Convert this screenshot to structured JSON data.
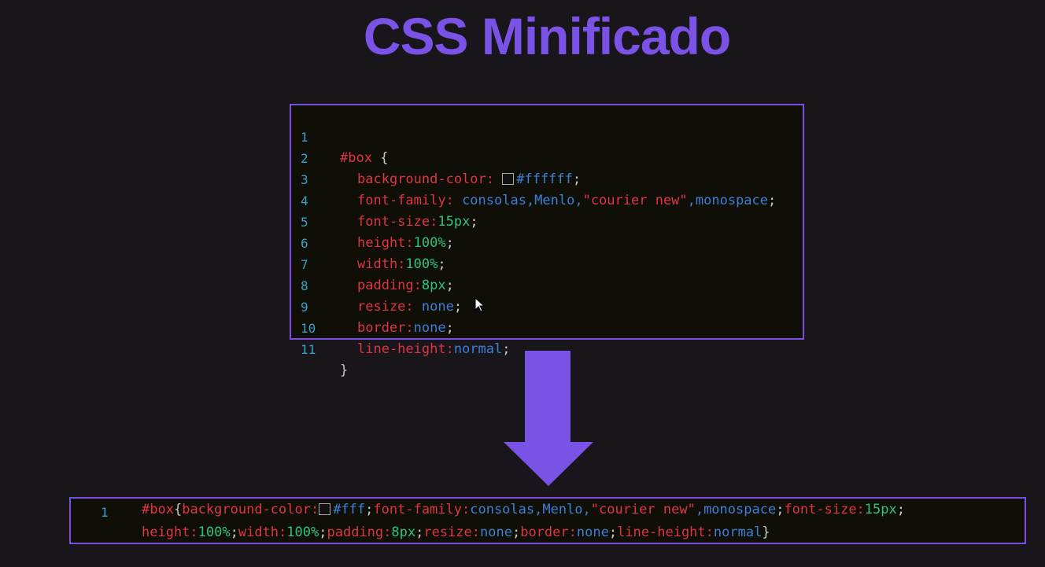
{
  "title": "CSS Minificado",
  "editor": {
    "lines": [
      {
        "n": "1"
      },
      {
        "n": "2"
      },
      {
        "n": "3"
      },
      {
        "n": "4"
      },
      {
        "n": "5"
      },
      {
        "n": "6"
      },
      {
        "n": "7"
      },
      {
        "n": "8"
      },
      {
        "n": "9"
      },
      {
        "n": "10"
      },
      {
        "n": "11"
      }
    ],
    "selector": "#box",
    "brace_open": " {",
    "brace_close": "}",
    "props": {
      "bg": "background-color: ",
      "bg_val": "#ffffff",
      "ff": "font-family: ",
      "ff_val1": "consolas,Menlo,",
      "ff_str": "\"courier new\"",
      "ff_val2": ",monospace",
      "fs": "font-size:",
      "fs_val": "15px",
      "h": "height:",
      "h_val": "100%",
      "w": "width:",
      "w_val": "100%",
      "p": "padding:",
      "p_val": "8px",
      "r": "resize: ",
      "r_val": "none",
      "b": "border:",
      "b_val": "none",
      "lh": "line-height:",
      "lh_val": "normal",
      "semi": ";"
    }
  },
  "minified": {
    "line_number": "1",
    "selector": "#box",
    "open": "{",
    "close": "}",
    "bg": "background-color:",
    "bg_val": "#fff",
    "ff": "font-family:",
    "ff_val1": "consolas,Menlo,",
    "ff_str": "\"courier new\"",
    "ff_val2": ",monospace",
    "fs": "font-size:",
    "fs_val": "15px",
    "h": "height:",
    "h_val": "100%",
    "w": "width:",
    "w_val": "100%",
    "p": "padding:",
    "p_val": "8px",
    "r": "resize:",
    "r_val": "none",
    "b": "border:",
    "b_val": "none",
    "lh": "line-height:",
    "lh_val": "normal",
    "semi": ";"
  },
  "colors": {
    "accent": "#7b52e6",
    "property": "#dd3543",
    "value": "#3b7fd9",
    "number": "#2ec27e",
    "line_number": "#3b9fc9"
  }
}
